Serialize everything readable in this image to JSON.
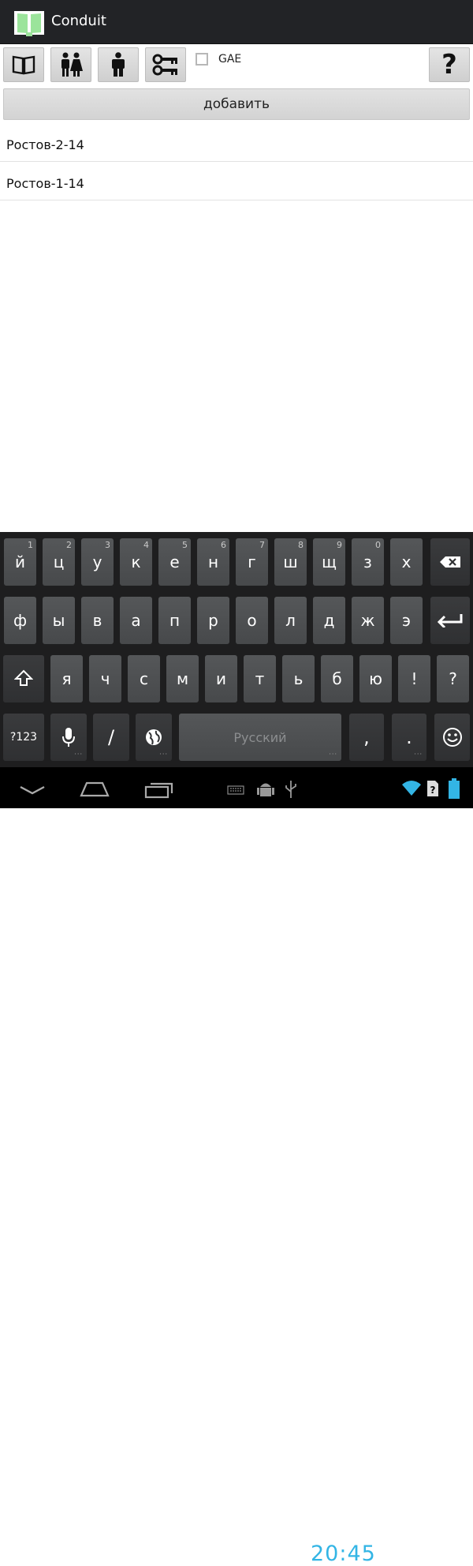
{
  "app": {
    "title": "Conduit"
  },
  "toolbar": {
    "gae_label": "GAE",
    "help_label": "?",
    "add_label": "добавить"
  },
  "list": [
    {
      "label": "Ростов-2-14"
    },
    {
      "label": "Ростов-1-14"
    }
  ],
  "keyboard": {
    "row1": [
      {
        "k": "й",
        "h": "1"
      },
      {
        "k": "ц",
        "h": "2"
      },
      {
        "k": "у",
        "h": "3"
      },
      {
        "k": "к",
        "h": "4"
      },
      {
        "k": "е",
        "h": "5"
      },
      {
        "k": "н",
        "h": "6"
      },
      {
        "k": "г",
        "h": "7"
      },
      {
        "k": "ш",
        "h": "8"
      },
      {
        "k": "щ",
        "h": "9"
      },
      {
        "k": "з",
        "h": "0"
      },
      {
        "k": "х",
        "h": ""
      }
    ],
    "row2": [
      "ф",
      "ы",
      "в",
      "а",
      "п",
      "р",
      "о",
      "л",
      "д",
      "ж",
      "э"
    ],
    "row3": [
      "я",
      "ч",
      "с",
      "м",
      "и",
      "т",
      "ь",
      "б",
      "ю",
      "!",
      "?"
    ],
    "symbols_label": "?123",
    "slash_label": "/",
    "space_label": "Русский",
    "comma_label": ",",
    "period_label": "."
  },
  "status": {
    "time": "20:45"
  },
  "colors": {
    "accent": "#33b5e5",
    "actionbar": "#222326",
    "keyboard_bg": "#1e1e1f"
  }
}
